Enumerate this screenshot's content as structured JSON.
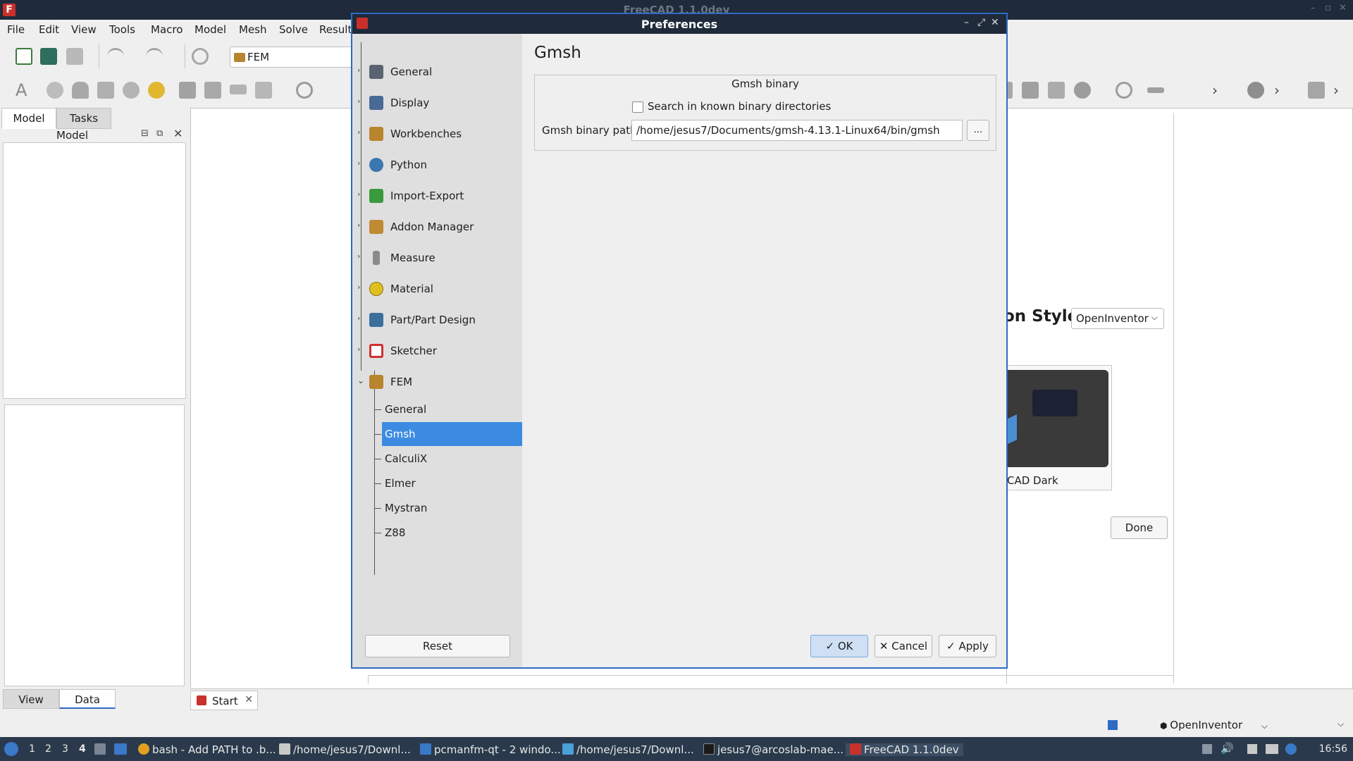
{
  "window": {
    "title": "FreeCAD 1.1.0dev"
  },
  "menu": [
    "File",
    "Edit",
    "View",
    "Tools",
    "Macro",
    "Model",
    "Mesh",
    "Solve",
    "Result"
  ],
  "toolbar": {
    "workbench": "FEM"
  },
  "combo_view": {
    "tabs": [
      "Model",
      "Tasks"
    ],
    "panel_title": "Model",
    "bottom_tabs": [
      "View",
      "Data"
    ]
  },
  "document_tabs": [
    {
      "label": "Start"
    }
  ],
  "start_page": {
    "nav_style_label": "on Style",
    "nav_style_value": "OpenInventor",
    "theme_caption": "CAD Dark",
    "done_label": "Done"
  },
  "statusbar": {
    "navigation": "OpenInventor"
  },
  "taskbar": {
    "workspaces": [
      "1",
      "2",
      "3",
      "4"
    ],
    "tasks": [
      "bash - Add PATH to .b...",
      "/home/jesus7/Downl...",
      "pcmanfm-qt - 2 windo...",
      "/home/jesus7/Downl...",
      "jesus7@arcoslab-mae...",
      "FreeCAD 1.1.0dev"
    ],
    "clock": "16:56"
  },
  "dialog": {
    "title": "Preferences",
    "tree": [
      {
        "label": "General",
        "icon": "tools-icon",
        "color": "#5a6470"
      },
      {
        "label": "Display",
        "icon": "monitor-icon",
        "color": "#4a6a96"
      },
      {
        "label": "Workbenches",
        "icon": "workbench-icon",
        "color": "#b8842e"
      },
      {
        "label": "Python",
        "icon": "python-icon",
        "color": "#3b77b0"
      },
      {
        "label": "Import-Export",
        "icon": "import-export-icon",
        "color": "#3b9a3e"
      },
      {
        "label": "Addon Manager",
        "icon": "addon-icon",
        "color": "#c08a34"
      },
      {
        "label": "Measure",
        "icon": "measure-icon",
        "color": "#8a8a8a"
      },
      {
        "label": "Material",
        "icon": "material-icon",
        "color": "#e0c020"
      },
      {
        "label": "Part/Part Design",
        "icon": "part-design-icon",
        "color": "#3a6f9c"
      },
      {
        "label": "Sketcher",
        "icon": "sketcher-icon",
        "color": "#d03030"
      },
      {
        "label": "FEM",
        "icon": "fem-icon",
        "color": "#b8842e"
      }
    ],
    "fem_children": [
      "General",
      "Gmsh",
      "CalculiX",
      "Elmer",
      "Mystran",
      "Z88"
    ],
    "selected": "Gmsh",
    "reset_label": "Reset",
    "page_title": "Gmsh",
    "group_title": "Gmsh binary",
    "search_label": "Search in known binary directories",
    "search_checked": false,
    "path_label": "Gmsh binary path",
    "path_value": "/home/jesus7/Documents/gmsh-4.13.1-Linux64/bin/gmsh",
    "browse_label": "...",
    "ok_label": "OK",
    "cancel_label": "Cancel",
    "apply_label": "Apply"
  },
  "colors": {
    "titlebar": "#1f2b3a",
    "selection": "#3c8be2",
    "taskbar": "#2a3a4c",
    "dialog_border": "#2e6bc5"
  }
}
